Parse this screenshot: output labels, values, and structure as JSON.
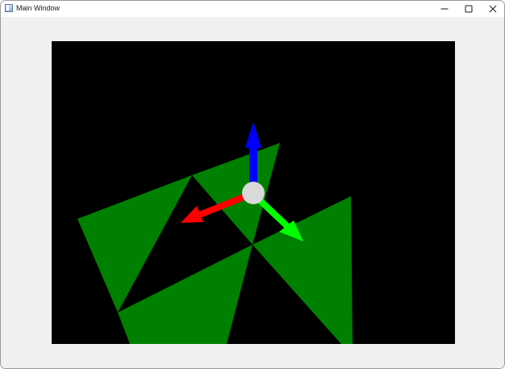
{
  "window": {
    "title": "Main Window",
    "icon": "app-window-icon",
    "controls": {
      "minimize_icon": "minimize-icon",
      "maximize_icon": "maximize-icon",
      "close_icon": "close-icon"
    }
  },
  "viewport": {
    "background_color": "#000000",
    "mesh_color": "#008000",
    "gizmo": {
      "x_axis_color": "#ff0000",
      "y_axis_color": "#0000ff",
      "z_axis_color": "#00ff00",
      "center_color": "#d9d9d9"
    }
  }
}
